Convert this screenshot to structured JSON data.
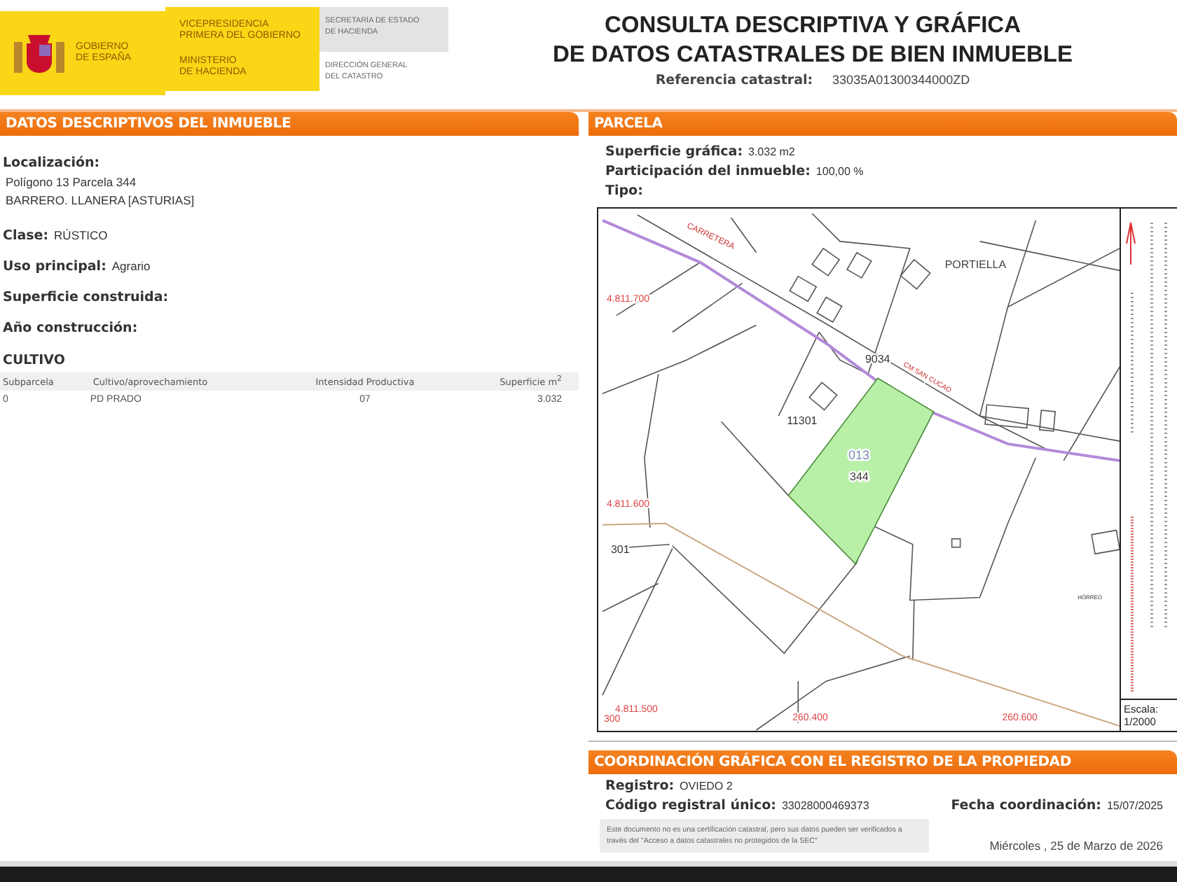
{
  "header": {
    "logo_blocks": [
      {
        "lines": [
          "GOBIERNO",
          "DE ESPAÑA"
        ]
      },
      {
        "lines": [
          "VICEPRESIDENCIA",
          "PRIMERA DEL GOBIERNO"
        ]
      },
      {
        "lines": [
          "MINISTERIO",
          "DE HACIENDA"
        ]
      },
      {
        "lines": [
          "SECRETARÍA DE ESTADO",
          "DE HACIENDA"
        ]
      },
      {
        "lines": [
          "DIRECCIÓN GENERAL",
          "DEL CATASTRO"
        ]
      }
    ],
    "title_lines": [
      "CONSULTA DESCRIPTIVA Y GRÁFICA",
      "DE DATOS CATASTRALES DE BIEN INMUEBLE"
    ],
    "reference": {
      "label": "Referencia catastral:",
      "value": "33035A01300344000ZD"
    }
  },
  "descriptive": {
    "title": "DATOS DESCRIPTIVOS DEL INMUEBLE",
    "location": {
      "label": "Localización:",
      "lines": [
        "Polígono 13 Parcela 344",
        "BARRERO. LLANERA [ASTURIAS]"
      ]
    },
    "fields": [
      {
        "label": "Clase:",
        "value": "RÚSTICO"
      },
      {
        "label": "Uso principal:",
        "value": "Agrario"
      },
      {
        "label": "Superficie construida:"
      },
      {
        "label": "Año construcción:"
      }
    ],
    "crop": {
      "title": "CULTIVO",
      "columns": [
        "Subparcela",
        "Cultivo/aprovechamiento",
        "Intensidad Productiva",
        "Superficie m$^{2}$"
      ],
      "rows": [
        [
          "0",
          "PD PRADO",
          "07",
          "3.032"
        ]
      ]
    }
  },
  "parcel": {
    "title": "PARCELA",
    "fields": [
      {
        "label": "Superficie gráfica:",
        "value": "3.032 m2"
      },
      {
        "label": "Participación del inmueble:",
        "value": "100,00 %"
      },
      {
        "label": "Tipo:"
      }
    ],
    "map_labels": [
      "CARRETERA",
      "PORTIELLA",
      "4.811.700",
      "9034",
      "CM SAN CUCAO",
      "11301",
      "013",
      "344",
      "4.811.600",
      "301",
      "HÓRREO",
      "4.811.500",
      "300",
      "260.400",
      "260.600"
    ],
    "scale": {
      "label": "Escala:",
      "value": "1/2000"
    }
  },
  "coordination": {
    "title": "COORDINACIÓN GRÁFICA CON EL REGISTRO DE LA PROPIEDAD",
    "fields": [
      {
        "label": "Registro:",
        "value": "OVIEDO 2"
      },
      {
        "label": "Código registral único:",
        "value": "33028000469373"
      },
      {
        "label": "Fecha coordinación:",
        "value": "15/07/2025"
      }
    ],
    "note": "Este documento no es una certificación catastral, pero sus datos pueden ser verificados a través del \"Acceso a datos catastrales no protegidos de la SEC\"",
    "date": "Miércoles , 25 de Marzo de 2026"
  }
}
